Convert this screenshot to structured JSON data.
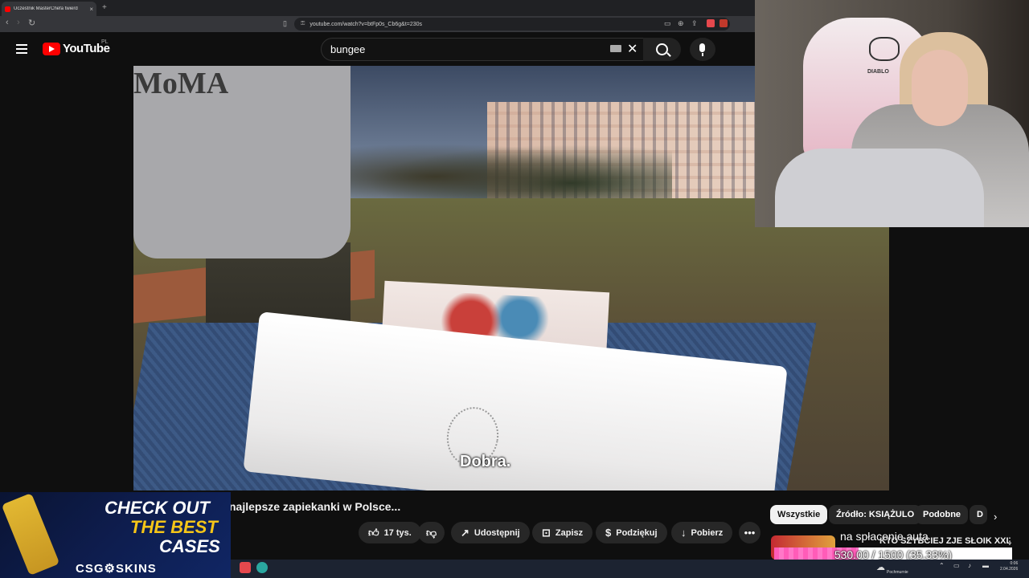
{
  "browser": {
    "tab_title": "Uczestnik MasterChefa twierd",
    "tab_close": "×",
    "new_tab": "+",
    "url": "youtube.com/watch?v=btFp0s_Cb6g&t=230s"
  },
  "youtube": {
    "logo_text": "YouTube",
    "country_code": "PL",
    "search_value": "bungee"
  },
  "video": {
    "subtitle": "Dobra.",
    "hoodie_text": "MoMA"
  },
  "webcam": {
    "chair_brand": "DIABLO"
  },
  "watch": {
    "title_visible": "najlepsze zapiekanki w Polsce...",
    "like_count": "17 tys.",
    "share_label": "Udostępnij",
    "save_label": "Zapisz",
    "thanks_label": "Podziękuj",
    "download_label": "Pobierz",
    "more_label": "•••"
  },
  "chips": [
    {
      "label": "Wszystkie"
    },
    {
      "label": "Źródło: KSIĄŻULO"
    },
    {
      "label": "Podobne"
    },
    {
      "label": "D"
    }
  ],
  "recommendation": {
    "title": "KTO SZYBCIEJ ZJE SŁOIK XXL"
  },
  "donation": {
    "label": "na spłacenie auta",
    "progress_text": "530.00 / 1500 (35.33%)",
    "progress_fraction": 0.3533
  },
  "ad": {
    "line1": "CHECK OUT",
    "line2": "THE BEST",
    "line3": "CASES",
    "brand": "CSG⚙SKINS",
    "line2_color": "#f5c518"
  },
  "taskbar": {
    "weather": "Pochmurnie",
    "time": "0:06",
    "date": "2.04.2026"
  },
  "colors": {
    "youtube_red": "#ff0000",
    "donation_pink": "#ff5cb8"
  }
}
